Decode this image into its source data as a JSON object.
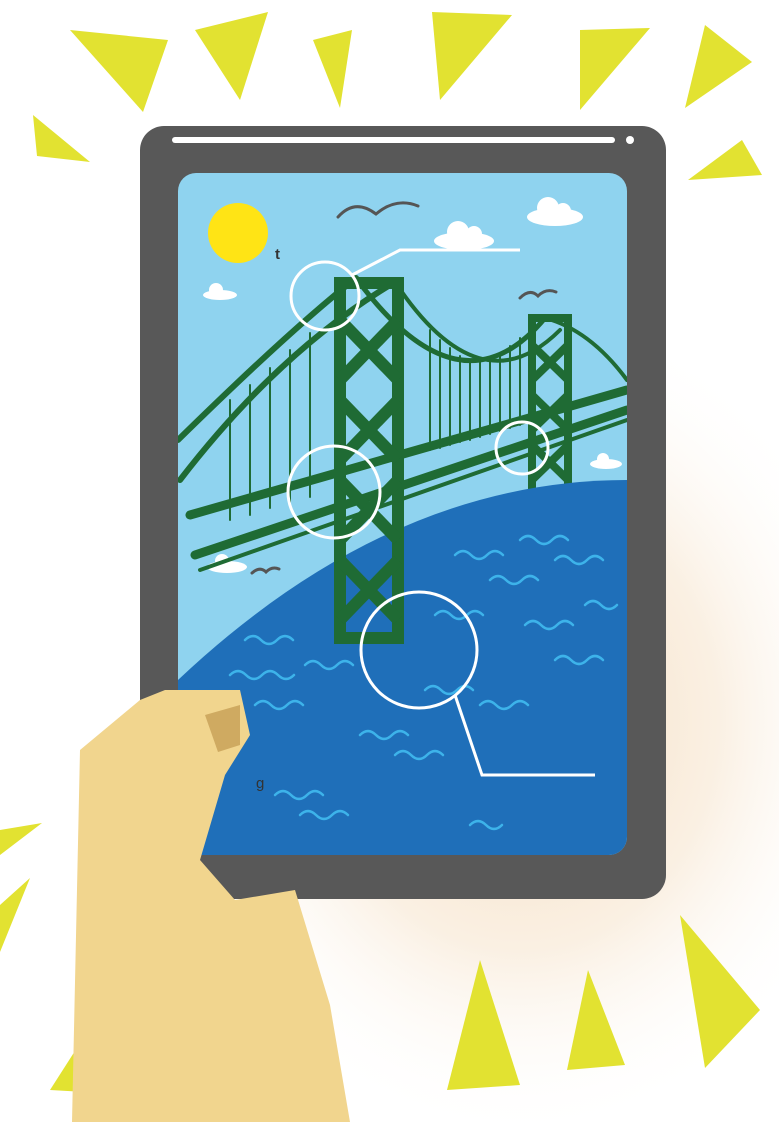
{
  "text_fragments": {
    "upper_right_char": "t",
    "lower_right_char": "g"
  },
  "colors": {
    "background": "#ffffff",
    "glow": "#f6e2c9",
    "sunburst": "#e2e231",
    "tablet_frame": "#585858",
    "speaker_bar": "#ffffff",
    "sky": "#8fd3ef",
    "sun": "#ffe415",
    "cloud": "#ffffff",
    "water": "#1f6fb9",
    "wave": "#3db3ea",
    "bridge": "#1f6b34",
    "hand": "#f1d58e",
    "thumbnail": "#cfaa61",
    "callout": "#ffffff",
    "bird": "#555555"
  }
}
